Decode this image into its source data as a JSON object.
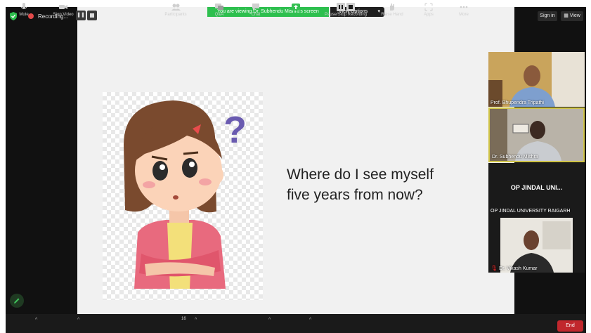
{
  "top_bar": {
    "recording_label": "Recording...",
    "viewing_banner": "You are viewing Dr. Subhendu Mishra's screen",
    "view_options_label": "View Options",
    "sign_in_label": "Sign in",
    "view_label": "View"
  },
  "shared_content": {
    "question_line1": "Where do I see myself",
    "question_line2": "five years from now?"
  },
  "participants": [
    {
      "name": "Prof. Bhupendra Tripathi"
    },
    {
      "name": "Dr. Subhendu Mishra"
    },
    {
      "name": "OP JINDAL UNI...",
      "subtitle": "OP JINDAL UNIVERSITY RAIGARH"
    },
    {
      "name": "Dr. Vikash Kumar"
    }
  ],
  "toolbar": {
    "mute": "Mute",
    "stop_video": "Stop Video",
    "participants": "Participants",
    "participants_count": "16",
    "qa": "Q&A",
    "chat": "Chat",
    "share_screen": "Share Screen",
    "pause_stop_recording": "Pause/Stop Recording",
    "raise_hand": "Raise Hand",
    "apps": "Apps",
    "more": "More",
    "end": "End"
  },
  "colors": {
    "banner_green": "#2dbf4e",
    "end_red": "#c1272d",
    "active_speaker": "#d1c548"
  }
}
